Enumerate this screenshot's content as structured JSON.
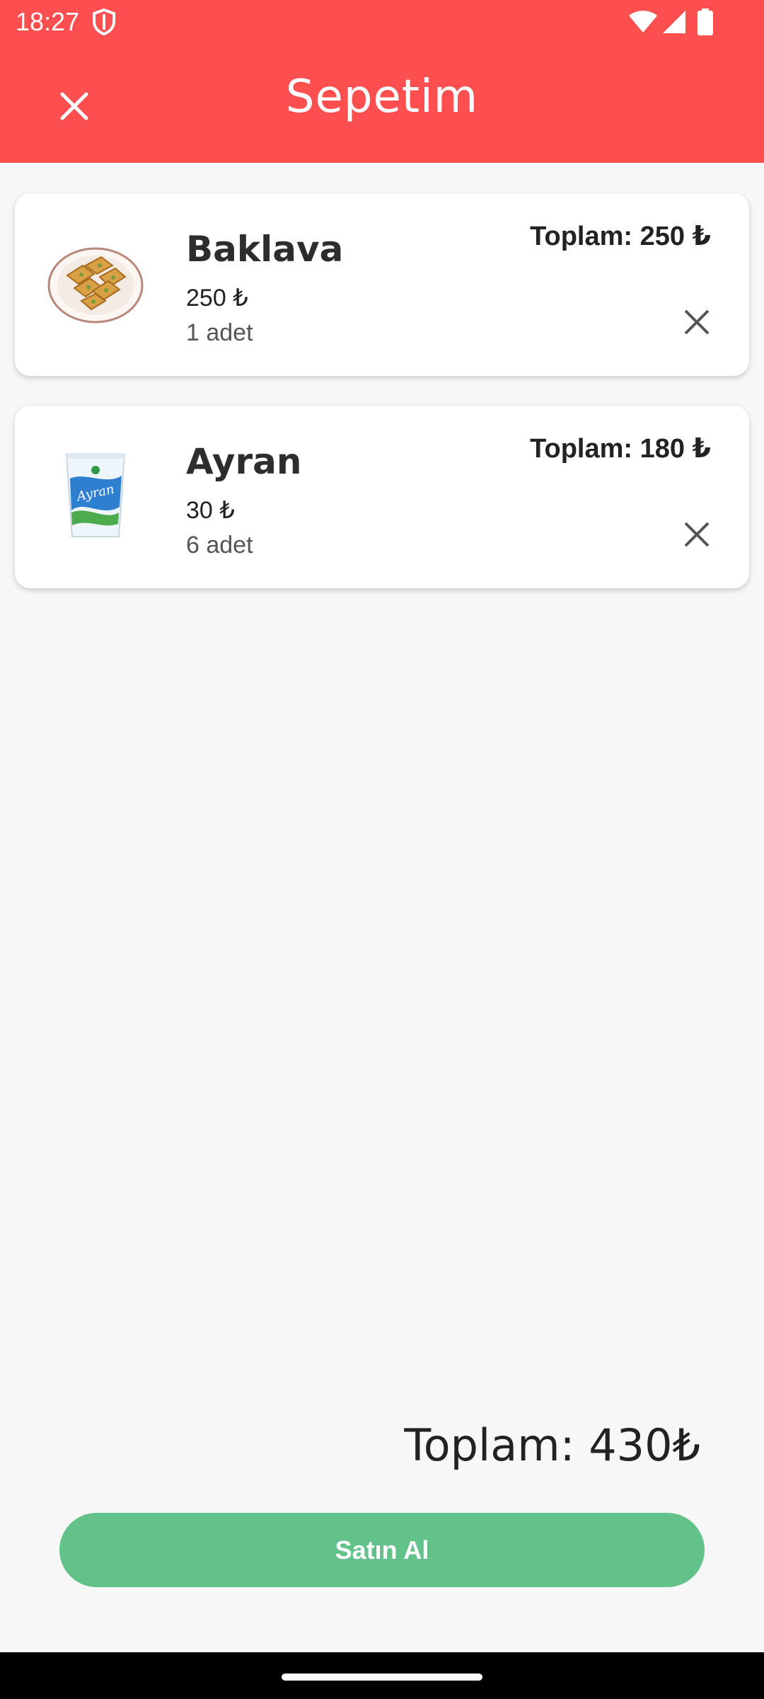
{
  "status_bar": {
    "time": "18:27"
  },
  "header": {
    "title": "Sepetim"
  },
  "cart": {
    "items": [
      {
        "name": "Baklava",
        "price": "250 ₺",
        "quantity": "1 adet",
        "total": "Toplam: 250 ₺",
        "image_icon": "baklava-plate"
      },
      {
        "name": "Ayran",
        "price": "30 ₺",
        "quantity": "6 adet",
        "total": "Toplam: 180 ₺",
        "image_icon": "ayran-cup"
      }
    ]
  },
  "footer": {
    "grand_total": "Toplam: 430₺",
    "buy_label": "Satın Al"
  },
  "colors": {
    "header": "#fd4f4f",
    "buy_button": "#63c28a",
    "background": "#f7f7f7"
  }
}
